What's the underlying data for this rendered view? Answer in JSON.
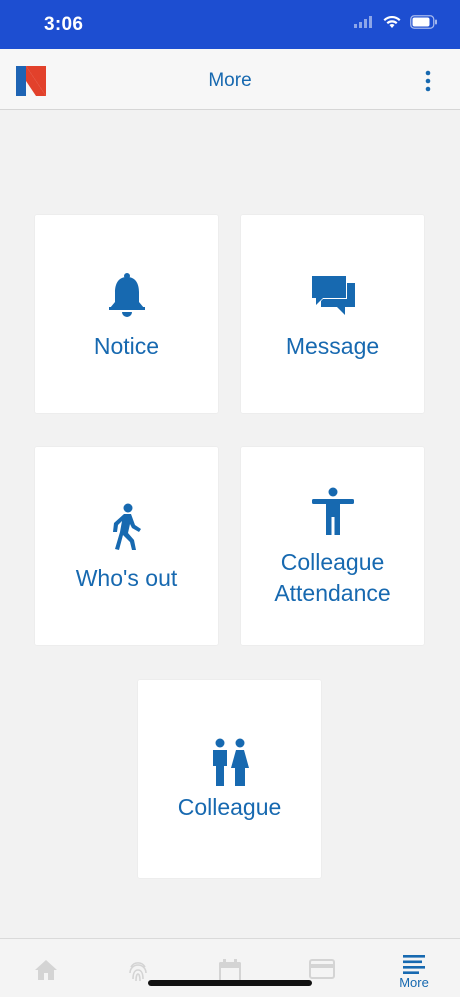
{
  "status": {
    "time": "3:06"
  },
  "header": {
    "title": "More"
  },
  "tiles": [
    {
      "label": "Notice",
      "icon": "bell-icon"
    },
    {
      "label": "Message",
      "icon": "chat-icon"
    },
    {
      "label": "Who's out",
      "icon": "walking-person-icon"
    },
    {
      "label_line1": "Colleague",
      "label_line2": "Attendance",
      "icon": "person-standing-icon"
    },
    {
      "label": "Colleague",
      "icon": "colleagues-icon"
    }
  ],
  "tabbar": {
    "items": [
      "home-icon",
      "fingerprint-icon",
      "calendar-icon",
      "card-icon",
      "menu-lines-icon"
    ],
    "more_label": "More",
    "active_color": "#1769b0"
  },
  "colors": {
    "accent": "#1769b0",
    "status_bar": "#1d4ed1",
    "background": "#f2f2f2"
  }
}
